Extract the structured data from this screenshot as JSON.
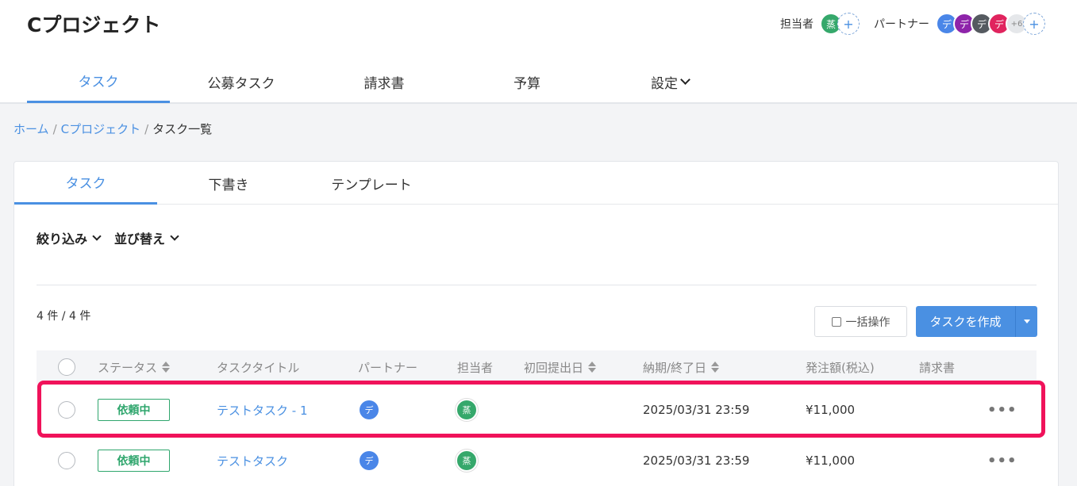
{
  "project": {
    "title": "Cプロジェクト"
  },
  "members": {
    "assignee_label": "担当者",
    "assignees": [
      {
        "initial": "蒸",
        "color": "#35a86b"
      }
    ],
    "partner_label": "パートナー",
    "partners": [
      {
        "initial": "デ",
        "color": "#4a86e8"
      },
      {
        "initial": "デ",
        "color": "#8e24aa"
      },
      {
        "initial": "デ",
        "color": "#555a60"
      },
      {
        "initial": "デ",
        "color": "#e0245e"
      }
    ],
    "more": "+6",
    "add": "+"
  },
  "nav": {
    "tabs": [
      {
        "label": "タスク",
        "active": true
      },
      {
        "label": "公募タスク"
      },
      {
        "label": "請求書"
      },
      {
        "label": "予算"
      },
      {
        "label": "設定"
      }
    ]
  },
  "breadcrumb": {
    "home": "ホーム",
    "sep": "/",
    "project": "Cプロジェクト",
    "current": "タスク一覧"
  },
  "subtabs": [
    {
      "label": "タスク",
      "active": true
    },
    {
      "label": "下書き"
    },
    {
      "label": "テンプレート"
    }
  ],
  "filters": {
    "filter": "絞り込み",
    "sort": "並び替え"
  },
  "count": "4 件 / 4 件",
  "actions": {
    "bulk": "一括操作",
    "create": "タスクを作成"
  },
  "table": {
    "headers": {
      "status": "ステータス",
      "title": "タスクタイトル",
      "partner": "パートナー",
      "assignee": "担当者",
      "first_submit": "初回提出日",
      "deadline": "納期/終了日",
      "amount": "発注額(税込)",
      "invoice": "請求書"
    },
    "rows": [
      {
        "status": "依頼中",
        "title": "テストタスク - 1",
        "partner": "デ",
        "assignee": "蒸",
        "first_submit": "",
        "deadline": "2025/03/31 23:59",
        "amount": "¥11,000",
        "invoice": "",
        "more": "•••"
      },
      {
        "status": "依頼中",
        "title": "テストタスク",
        "partner": "デ",
        "assignee": "蒸",
        "first_submit": "",
        "deadline": "2025/03/31 23:59",
        "amount": "¥11,000",
        "invoice": "",
        "more": "•••"
      }
    ]
  },
  "colors": {
    "accent": "#4a90e2",
    "status": "#2fa66d",
    "highlight": "#f0125a"
  }
}
